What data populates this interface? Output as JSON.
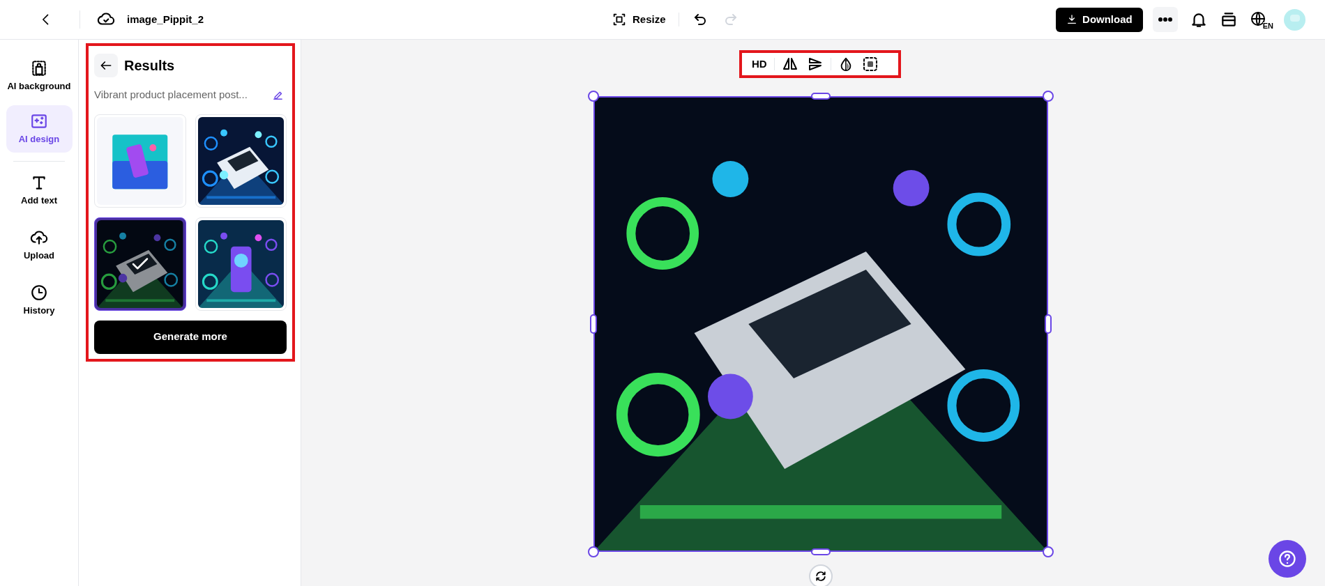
{
  "top_bar": {
    "title": "image_Pippit_2",
    "resize_label": "Resize",
    "undo_enabled": true,
    "redo_enabled": false,
    "download_label": "Download",
    "language": "EN"
  },
  "rail": {
    "top": [
      {
        "kind": "background",
        "label": "AI background",
        "selected": false
      },
      {
        "kind": "design",
        "label": "AI design",
        "selected": true
      }
    ],
    "bottom": [
      {
        "kind": "text",
        "label": "Add text",
        "selected": false
      },
      {
        "kind": "upload",
        "label": "Upload",
        "selected": false
      },
      {
        "kind": "history",
        "label": "History",
        "selected": false
      }
    ]
  },
  "panel": {
    "title": "Results",
    "highlighted": true,
    "prompt": "Vibrant product placement post...",
    "results": [
      {
        "kind": "picture",
        "selected": false
      },
      {
        "kind": "picture",
        "selected": false
      },
      {
        "kind": "picture",
        "selected": true
      },
      {
        "kind": "picture",
        "selected": false
      }
    ],
    "button": "Generate more"
  },
  "toolbar": {
    "highlighted": true,
    "hd_label": "HD"
  },
  "canvas": {
    "selected": true,
    "image": {
      "kind": "picture"
    }
  }
}
